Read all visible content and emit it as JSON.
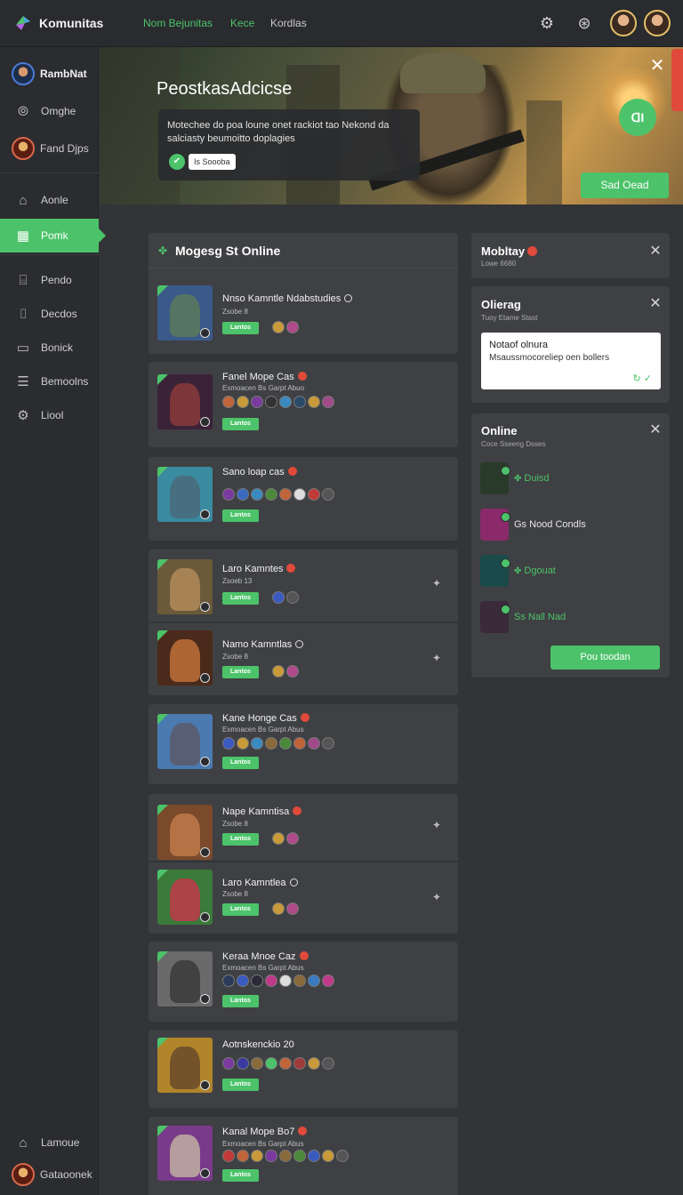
{
  "app": {
    "name": "Komunitas",
    "accent": "#4cc36a"
  },
  "topnav": [
    "Nom Bejunitas",
    "Kece",
    "Kordlas"
  ],
  "sidebar": {
    "items": [
      {
        "label": "RambNat",
        "icon": "avatar"
      },
      {
        "label": "Omghe",
        "icon": "wifi-icon"
      },
      {
        "label": "Fand Djps",
        "icon": "avatar"
      },
      {
        "label": "Aonle",
        "icon": "home-icon"
      },
      {
        "label": "Pomk",
        "icon": "grid-icon"
      },
      {
        "label": "Pendo",
        "icon": "building-icon"
      },
      {
        "label": "Decdos",
        "icon": "briefcase-icon"
      },
      {
        "label": "Bonick",
        "icon": "card-icon"
      },
      {
        "label": "Bemoolns",
        "icon": "list-icon"
      },
      {
        "label": "Liool",
        "icon": "gear-icon"
      }
    ],
    "active": "Pomk",
    "bottom": [
      {
        "label": "Lamoue",
        "icon": "home-icon"
      },
      {
        "label": "Gataoonek",
        "icon": "avatar"
      }
    ]
  },
  "hero": {
    "title": "PeostkasAdcicse",
    "description": "Motechee do poa loune onet rackiot tao Nekond da salciasty beumoitto doplagies",
    "tag": "Is Soooba",
    "button": "Sad Oead",
    "fab": "ᗡI"
  },
  "list": {
    "title": "Mogesg St Online",
    "cards": [
      {
        "name": "Nnso Kamntle Ndabstudies",
        "marker": "ring",
        "sub": "Zsobe 8",
        "badge": "Lantos",
        "icons": 2
      },
      {
        "name": "Fanel Mope Cas",
        "marker": "dot",
        "sub": "Exmoacen Bs Garpt Abuo",
        "badge": "Lantos",
        "icons": 9
      },
      {
        "name": "Sano loap cas",
        "marker": "dot",
        "sub": "",
        "badge": "Lantos",
        "icons": 9
      },
      {
        "name": "Laro Kamntes",
        "marker": "dot",
        "sub": "Zsoeb 13",
        "badge": "Lantos",
        "icons": 2
      },
      {
        "name": "Namo Kamntlas",
        "marker": "ring",
        "sub": "Zsobe 8",
        "badge": "Lantos",
        "icons": 2
      },
      {
        "name": "Kane Honge Cas",
        "marker": "dot",
        "sub": "Exmoacen Bs Garpt Abus",
        "badge": "Lantos",
        "icons": 9
      },
      {
        "name": "Nape Kamntisa",
        "marker": "dot",
        "sub": "Zsobe 8",
        "badge": "Lantos",
        "icons": 2
      },
      {
        "name": "Laro Kamntlea",
        "marker": "ring",
        "sub": "Zsobe 8",
        "badge": "Lantos",
        "icons": 2
      },
      {
        "name": "Keraa Mnoe Caz",
        "marker": "dot",
        "sub": "Exmoacen Bs Garpt Abus",
        "badge": "Lantos",
        "icons": 9
      },
      {
        "name": "Aotnskenckio 20",
        "marker": "none",
        "sub": "",
        "badge": "Lantos",
        "icons": 9
      },
      {
        "name": "Kanal Mope Bo7",
        "marker": "dot",
        "sub": "Exmoacen Bs Garpt Abus",
        "badge": "Lantos",
        "icons": 9
      }
    ]
  },
  "right": {
    "mobitay": {
      "title": "Mobltay",
      "sub": "Lowe 6680"
    },
    "olierag": {
      "title": "Olierag",
      "sub": "Tuoy Etame Stast",
      "note_title": "Notaof olnura",
      "note_body": "Msaussmocoreliep oen bollers"
    },
    "online": {
      "title": "Online",
      "sub": "Coce Sseeng Dsses",
      "users": [
        {
          "label": "Duisd"
        },
        {
          "label": "Nood Condls",
          "prefix": "Gs"
        },
        {
          "label": "Dgouat"
        },
        {
          "label": "Nall Nad",
          "prefix": "Ss"
        }
      ],
      "button": "Pou toodan"
    }
  }
}
